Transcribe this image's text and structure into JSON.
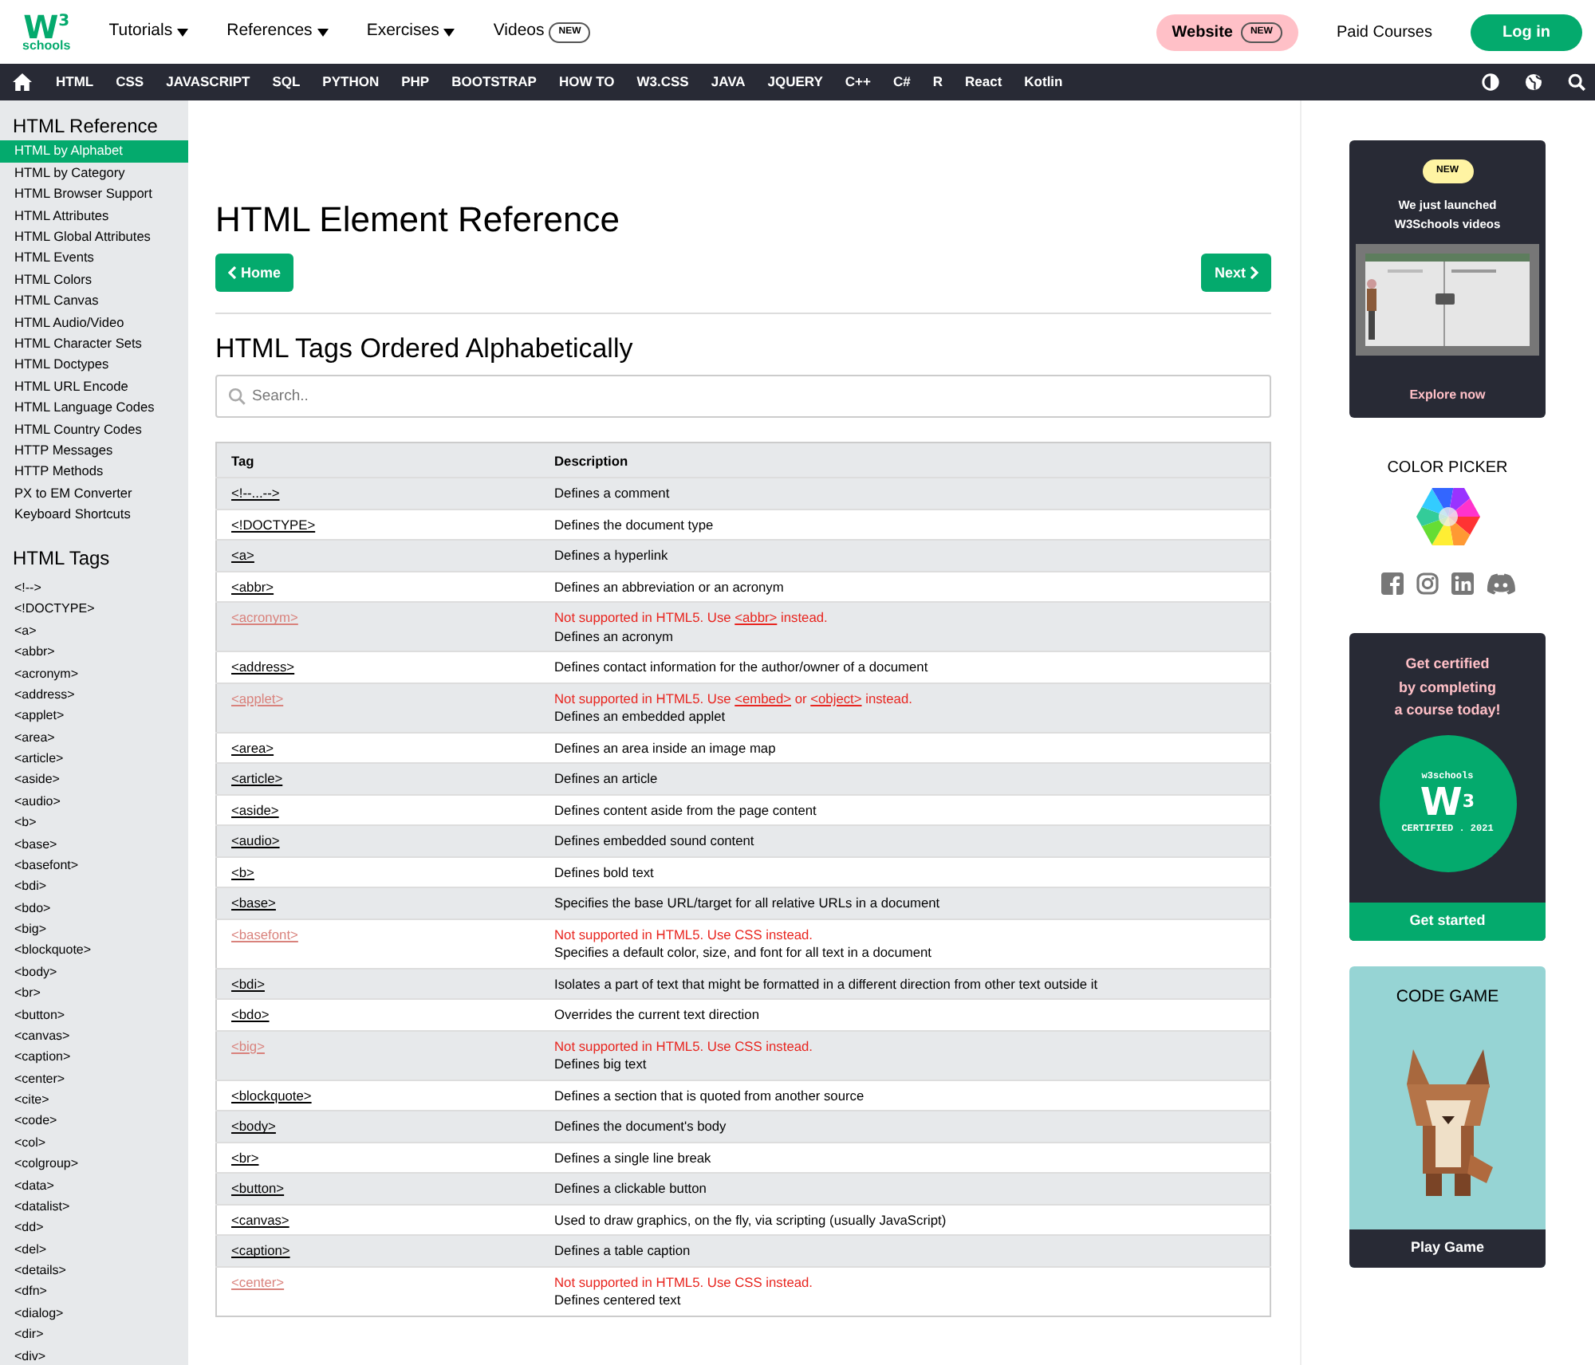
{
  "logo": {
    "mark": "W",
    "sup": "3",
    "name": "schools"
  },
  "top_menu": [
    {
      "label": "Tutorials",
      "dropdown": true
    },
    {
      "label": "References",
      "dropdown": true
    },
    {
      "label": "Exercises",
      "dropdown": true
    },
    {
      "label": "Videos",
      "dropdown": false,
      "badge": "NEW"
    }
  ],
  "top_right": {
    "website": {
      "label": "Website",
      "badge": "NEW"
    },
    "paid": "Paid Courses",
    "login": "Log in"
  },
  "nav": [
    "HTML",
    "CSS",
    "JAVASCRIPT",
    "SQL",
    "PYTHON",
    "PHP",
    "BOOTSTRAP",
    "HOW TO",
    "W3.CSS",
    "JAVA",
    "JQUERY",
    "C++",
    "C#",
    "R",
    "React",
    "Kotlin"
  ],
  "sidebar": {
    "reference_title": "HTML Reference",
    "reference_items": [
      {
        "label": "HTML by Alphabet",
        "selected": true
      },
      {
        "label": "HTML by Category",
        "selected": false
      },
      {
        "label": "HTML Browser Support",
        "selected": false
      },
      {
        "label": "HTML Attributes",
        "selected": false
      },
      {
        "label": "HTML Global Attributes",
        "selected": false
      },
      {
        "label": "HTML Events",
        "selected": false
      },
      {
        "label": "HTML Colors",
        "selected": false
      },
      {
        "label": "HTML Canvas",
        "selected": false
      },
      {
        "label": "HTML Audio/Video",
        "selected": false
      },
      {
        "label": "HTML Character Sets",
        "selected": false
      },
      {
        "label": "HTML Doctypes",
        "selected": false
      },
      {
        "label": "HTML URL Encode",
        "selected": false
      },
      {
        "label": "HTML Language Codes",
        "selected": false
      },
      {
        "label": "HTML Country Codes",
        "selected": false
      },
      {
        "label": "HTTP Messages",
        "selected": false
      },
      {
        "label": "HTTP Methods",
        "selected": false
      },
      {
        "label": "PX to EM Converter",
        "selected": false
      },
      {
        "label": "Keyboard Shortcuts",
        "selected": false
      }
    ],
    "tags_title": "HTML Tags",
    "tags": [
      "<!-->",
      "<!DOCTYPE>",
      "<a>",
      "<abbr>",
      "<acronym>",
      "<address>",
      "<applet>",
      "<area>",
      "<article>",
      "<aside>",
      "<audio>",
      "<b>",
      "<base>",
      "<basefont>",
      "<bdi>",
      "<bdo>",
      "<big>",
      "<blockquote>",
      "<body>",
      "<br>",
      "<button>",
      "<canvas>",
      "<caption>",
      "<center>",
      "<cite>",
      "<code>",
      "<col>",
      "<colgroup>",
      "<data>",
      "<datalist>",
      "<dd>",
      "<del>",
      "<details>",
      "<dfn>",
      "<dialog>",
      "<dir>",
      "<div>"
    ]
  },
  "main": {
    "title": "HTML Element Reference",
    "prev_button": "Home",
    "next_button": "Next",
    "subtitle": "HTML Tags Ordered Alphabetically",
    "search": {
      "placeholder": "Search.."
    },
    "table": {
      "columns": [
        "Tag",
        "Description"
      ],
      "rows": [
        {
          "tag": "<!--...-->",
          "description": "Defines a comment",
          "deprecated": false
        },
        {
          "tag": "<!DOCTYPE>",
          "description": "Defines the document type",
          "deprecated": false
        },
        {
          "tag": "<a>",
          "description": "Defines a hyperlink",
          "deprecated": false
        },
        {
          "tag": "<abbr>",
          "description": "Defines an abbreviation or an acronym",
          "deprecated": false
        },
        {
          "tag": "<acronym>",
          "description": "Defines an acronym",
          "deprecated": true,
          "note": [
            {
              "kind": "text",
              "text": "Not supported in HTML5. Use "
            },
            {
              "kind": "link",
              "text": "<abbr>"
            },
            {
              "kind": "text",
              "text": " instead."
            }
          ]
        },
        {
          "tag": "<address>",
          "description": "Defines contact information for the author/owner of a document",
          "deprecated": false
        },
        {
          "tag": "<applet>",
          "description": "Defines an embedded applet",
          "deprecated": true,
          "note": [
            {
              "kind": "text",
              "text": "Not supported in HTML5. Use "
            },
            {
              "kind": "link",
              "text": "<embed>"
            },
            {
              "kind": "text",
              "text": " or "
            },
            {
              "kind": "link",
              "text": "<object>"
            },
            {
              "kind": "text",
              "text": " instead."
            }
          ]
        },
        {
          "tag": "<area>",
          "description": "Defines an area inside an image map",
          "deprecated": false
        },
        {
          "tag": "<article>",
          "description": "Defines an article",
          "deprecated": false
        },
        {
          "tag": "<aside>",
          "description": "Defines content aside from the page content",
          "deprecated": false
        },
        {
          "tag": "<audio>",
          "description": "Defines embedded sound content",
          "deprecated": false
        },
        {
          "tag": "<b>",
          "description": "Defines bold text",
          "deprecated": false
        },
        {
          "tag": "<base>",
          "description": "Specifies the base URL/target for all relative URLs in a document",
          "deprecated": false
        },
        {
          "tag": "<basefont>",
          "description": "Specifies a default color, size, and font for all text in a document",
          "deprecated": true,
          "note": [
            {
              "kind": "text",
              "text": "Not supported in HTML5. Use CSS instead."
            }
          ]
        },
        {
          "tag": "<bdi>",
          "description": "Isolates a part of text that might be formatted in a different direction from other text outside it",
          "deprecated": false
        },
        {
          "tag": "<bdo>",
          "description": "Overrides the current text direction",
          "deprecated": false
        },
        {
          "tag": "<big>",
          "description": "Defines big text",
          "deprecated": true,
          "note": [
            {
              "kind": "text",
              "text": "Not supported in HTML5. Use CSS instead."
            }
          ]
        },
        {
          "tag": "<blockquote>",
          "description": "Defines a section that is quoted from another source",
          "deprecated": false
        },
        {
          "tag": "<body>",
          "description": "Defines the document's body",
          "deprecated": false
        },
        {
          "tag": "<br>",
          "description": "Defines a single line break",
          "deprecated": false
        },
        {
          "tag": "<button>",
          "description": "Defines a clickable button",
          "deprecated": false
        },
        {
          "tag": "<canvas>",
          "description": "Used to draw graphics, on the fly, via scripting (usually JavaScript)",
          "deprecated": false
        },
        {
          "tag": "<caption>",
          "description": "Defines a table caption",
          "deprecated": false
        },
        {
          "tag": "<center>",
          "description": "Defines centered text",
          "deprecated": true,
          "note": [
            {
              "kind": "text",
              "text": "Not supported in HTML5. Use CSS instead."
            }
          ]
        }
      ]
    }
  },
  "ads": {
    "video": {
      "badge": "NEW",
      "text_lines": [
        "We just launched",
        "W3Schools videos"
      ],
      "link": "Explore now"
    },
    "color_picker": {
      "title": "COLOR PICKER"
    },
    "certified": {
      "text_lines": [
        "Get certified",
        "by completing",
        "a course today!"
      ],
      "badge_top": "w3schools",
      "badge_mark": "W",
      "badge_sup": "3",
      "badge_bottom": "CERTIFIED . 2021",
      "button": "Get started"
    },
    "game": {
      "title": "CODE GAME",
      "button": "Play Game"
    }
  }
}
